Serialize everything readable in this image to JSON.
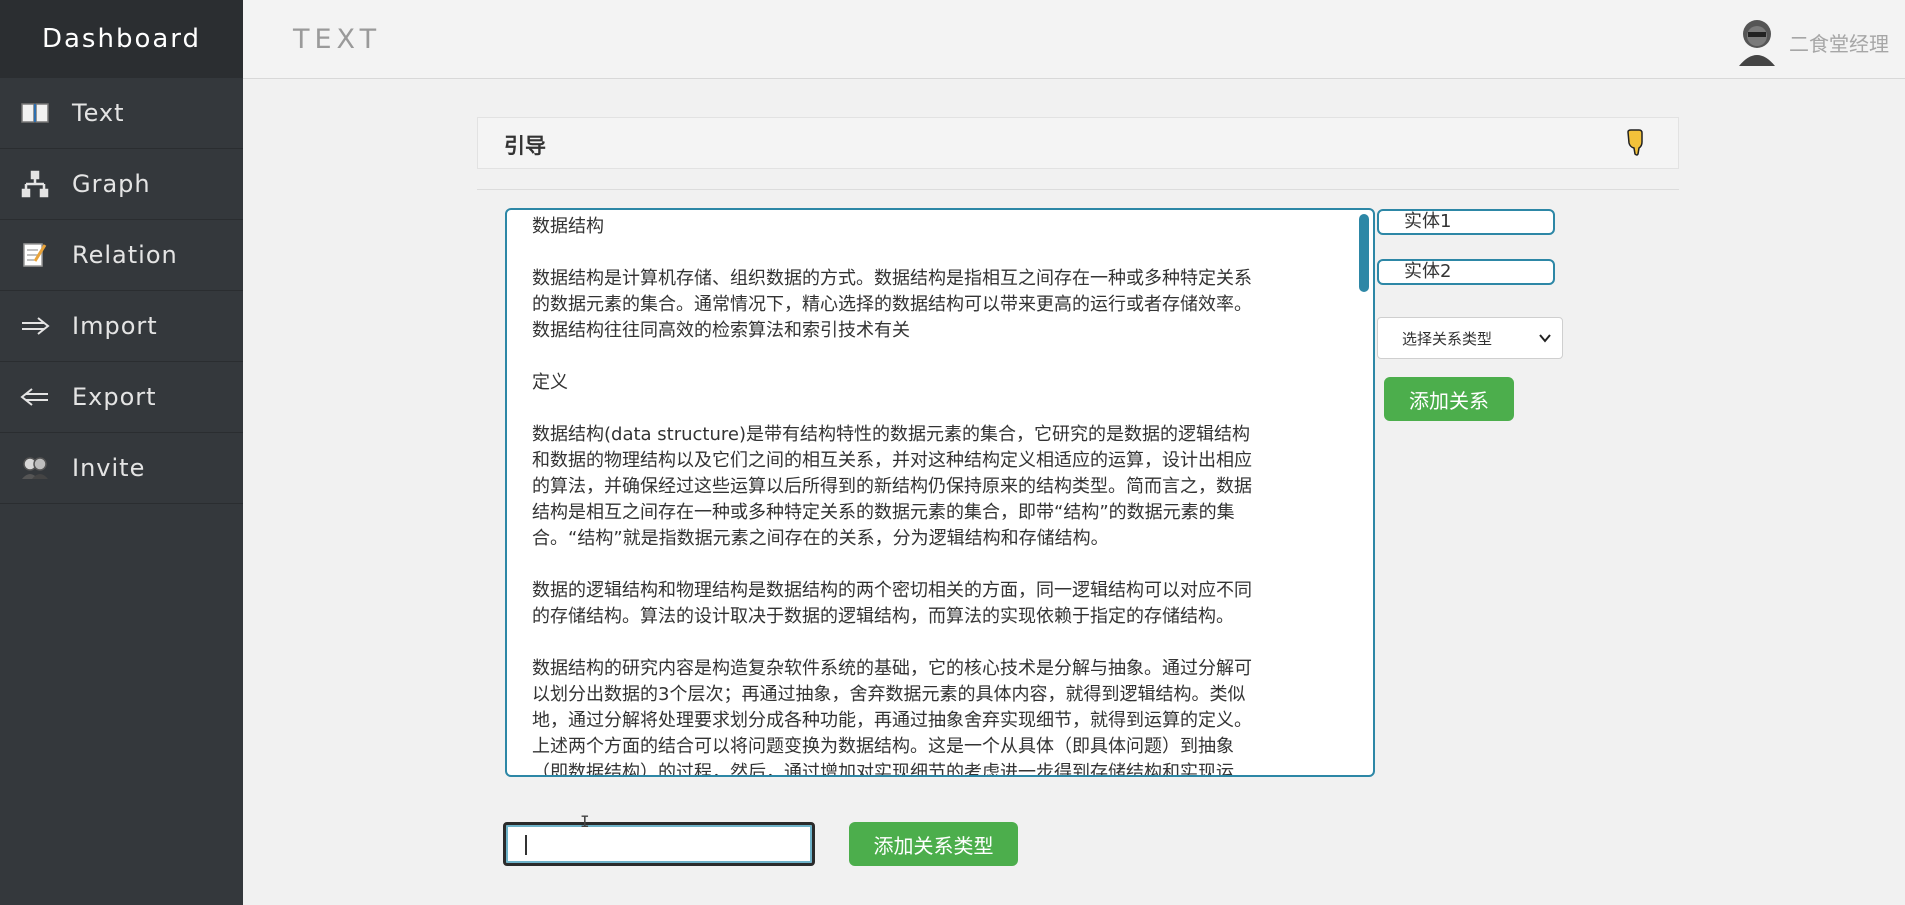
{
  "brand": "Dashboard",
  "header": {
    "title": "TEXT",
    "user_name": "二食堂经理"
  },
  "sidebar": {
    "items": [
      {
        "label": "Text",
        "icon": "book-icon"
      },
      {
        "label": "Graph",
        "icon": "hierarchy-icon"
      },
      {
        "label": "Relation",
        "icon": "memo-icon"
      },
      {
        "label": "Import",
        "icon": "arrow-right-icon"
      },
      {
        "label": "Export",
        "icon": "arrow-left-icon"
      },
      {
        "label": "Invite",
        "icon": "users-icon"
      }
    ]
  },
  "guide": {
    "title": "引导",
    "icon": "pointing-hand-icon"
  },
  "editor": {
    "text": "数据结构\n\n数据结构是计算机存储、组织数据的方式。数据结构是指相互之间存在一种或多种特定关系\n的数据元素的集合。通常情况下，精心选择的数据结构可以带来更高的运行或者存储效率。\n数据结构往往同高效的检索算法和索引技术有关\n\n定义\n\n数据结构(data structure)是带有结构特性的数据元素的集合，它研究的是数据的逻辑结构\n和数据的物理结构以及它们之间的相互关系，并对这种结构定义相适应的运算，设计出相应\n的算法，并确保经过这些运算以后所得到的新结构仍保持原来的结构类型。简而言之，数据\n结构是相互之间存在一种或多种特定关系的数据元素的集合，即带“结构”的数据元素的集\n合。“结构”就是指数据元素之间存在的关系，分为逻辑结构和存储结构。\n\n数据的逻辑结构和物理结构是数据结构的两个密切相关的方面，同一逻辑结构可以对应不同\n的存储结构。算法的设计取决于数据的逻辑结构，而算法的实现依赖于指定的存储结构。\n\n数据结构的研究内容是构造复杂软件系统的基础，它的核心技术是分解与抽象。通过分解可\n以划分出数据的3个层次；再通过抽象，舍弃数据元素的具体内容，就得到逻辑结构。类似\n地，通过分解将处理要求划分成各种功能，再通过抽象舍弃实现细节，就得到运算的定义。\n上述两个方面的结合可以将问题变换为数据结构。这是一个从具体（即具体问题）到抽象\n（即数据结构）的过程，然后，通过增加对实现细节的考虑进一步得到存储结构和实现运"
  },
  "controls": {
    "entity1": "实体1",
    "entity2": "实体2",
    "relation_select": "选择关系类型",
    "add_relation": "添加关系",
    "new_type_value": "",
    "add_relation_type": "添加关系类型"
  },
  "colors": {
    "accent_blue": "#2d87a6",
    "green": "#4cae4c",
    "sidebar": "#34383c"
  }
}
